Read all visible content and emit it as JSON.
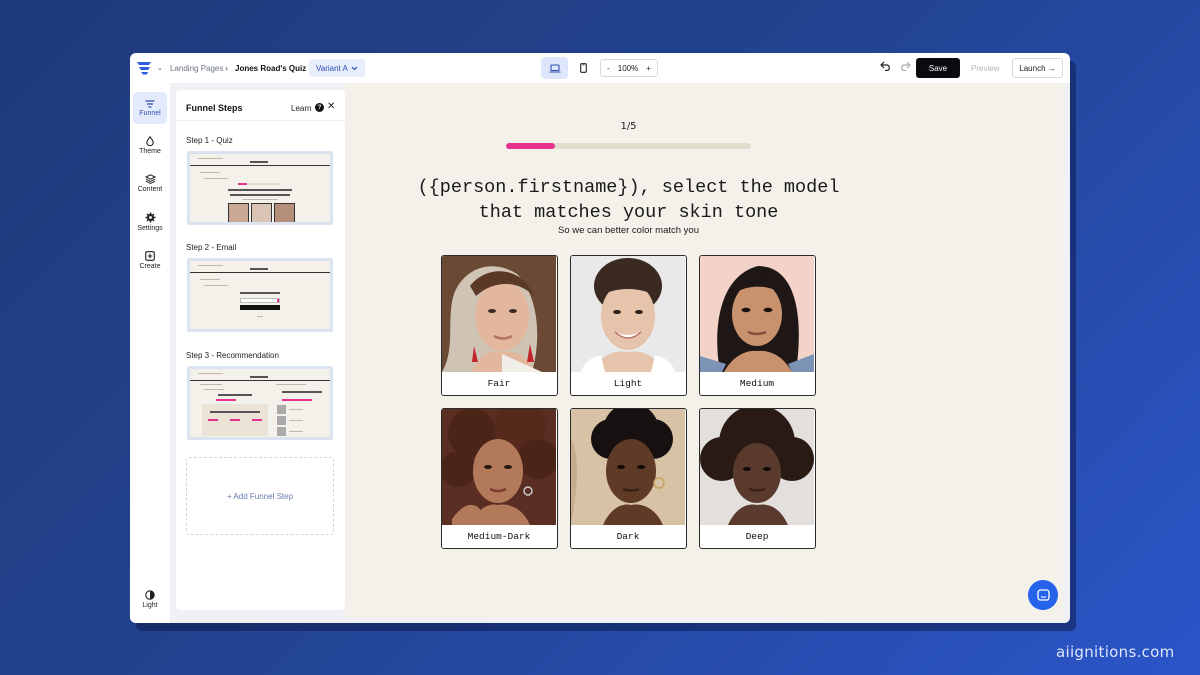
{
  "topbar": {
    "breadcrumb_root": "Landing Pages",
    "breadcrumb_current": "Jones Road's Quiz",
    "variant": "Variant A",
    "zoom_minus": "-",
    "zoom_level": "100%",
    "zoom_plus": "+",
    "save_label": "Save",
    "preview_label": "Preview",
    "launch_label": "Launch →"
  },
  "rail": {
    "items": [
      {
        "label": "Funnel",
        "icon": "filter-icon"
      },
      {
        "label": "Theme",
        "icon": "droplet-icon"
      },
      {
        "label": "Content",
        "icon": "layers-icon"
      },
      {
        "label": "Settings",
        "icon": "gear-icon"
      },
      {
        "label": "Create",
        "icon": "plus-square-icon"
      }
    ],
    "mode_label": "Light"
  },
  "panel": {
    "title": "Funnel Steps",
    "learn_label": "Learn",
    "help_glyph": "?",
    "close_glyph": "✕",
    "steps": [
      {
        "label": "Step 1 - Quiz"
      },
      {
        "label": "Step 2 - Email"
      },
      {
        "label": "Step 3 - Recommendation"
      }
    ],
    "add_step_label": "+ Add Funnel Step"
  },
  "quiz": {
    "counter": "1/5",
    "progress": 0.2,
    "heading": "({person.firstname}), select the model that matches your skin tone",
    "subheading": "So we can better color match you",
    "options": [
      {
        "label": "Fair"
      },
      {
        "label": "Light"
      },
      {
        "label": "Medium"
      },
      {
        "label": "Medium-Dark"
      },
      {
        "label": "Dark"
      },
      {
        "label": "Deep"
      }
    ]
  },
  "colors": {
    "accent": "#e4338f",
    "primary_blue": "#2563eb",
    "canvas_bg": "#f4f1ea"
  },
  "watermark": "aiignitions.com"
}
